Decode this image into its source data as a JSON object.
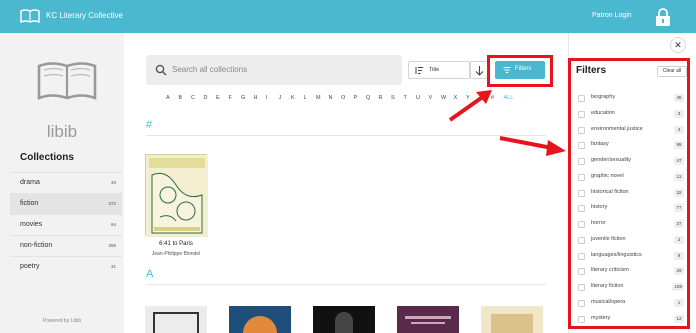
{
  "header": {
    "app_title": "KC Literary Collective",
    "patron_login": "Patron Login"
  },
  "sidebar": {
    "logo_text": "libib",
    "collections_title": "Collections",
    "collections": [
      {
        "name": "drama",
        "count": "30"
      },
      {
        "name": "fiction",
        "count": "372"
      },
      {
        "name": "movies",
        "count": "94"
      },
      {
        "name": "non-fiction",
        "count": "289"
      },
      {
        "name": "poetry",
        "count": "31"
      }
    ],
    "powered_by": "Powered by Libib"
  },
  "search": {
    "placeholder": "Search all collections"
  },
  "sort": {
    "label": "Title"
  },
  "filters_button": {
    "label": "Filters"
  },
  "alphabet": [
    "A",
    "B",
    "C",
    "D",
    "E",
    "F",
    "G",
    "H",
    "I",
    "J",
    "K",
    "L",
    "M",
    "N",
    "O",
    "P",
    "Q",
    "R",
    "S",
    "T",
    "U",
    "V",
    "W",
    "X",
    "Y",
    "Z",
    "#",
    "ALL"
  ],
  "sections": {
    "hash": "#",
    "a": "A"
  },
  "books": [
    {
      "title": "6:41 to Paris",
      "author": "Jean-Philippe Blondel"
    }
  ],
  "filters_panel": {
    "title": "Filters",
    "clear_all": "Clear all",
    "items": [
      {
        "name": "biography",
        "count": "45"
      },
      {
        "name": "education",
        "count": "3"
      },
      {
        "name": "environmental justice",
        "count": "4"
      },
      {
        "name": "fantasy",
        "count": "95"
      },
      {
        "name": "gender/sexuality",
        "count": "47"
      },
      {
        "name": "graphic novel",
        "count": "11"
      },
      {
        "name": "historical fiction",
        "count": "32"
      },
      {
        "name": "history",
        "count": "77"
      },
      {
        "name": "horror",
        "count": "37"
      },
      {
        "name": "juvenile fiction",
        "count": "2"
      },
      {
        "name": "languages/linguistics",
        "count": "9"
      },
      {
        "name": "literary criticism",
        "count": "29"
      },
      {
        "name": "literary fiction",
        "count": "159"
      },
      {
        "name": "musical/opera",
        "count": "1"
      },
      {
        "name": "mystery",
        "count": "12"
      }
    ]
  },
  "colors": {
    "accent": "#4ab8cf",
    "annotation_red": "#e8141b"
  }
}
